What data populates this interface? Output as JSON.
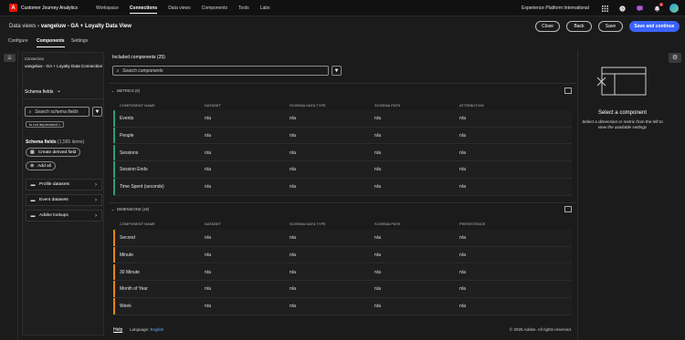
{
  "topbar": {
    "logo": "A",
    "app_title": "Customer Journey Analytics",
    "nav": [
      "Workspace",
      "Connections",
      "Data views",
      "Components",
      "Tools",
      "Labs"
    ],
    "active_nav": "Connections",
    "org_name": "Experience Platform International",
    "notification_count": "1",
    "icons": [
      "apps-grid-icon",
      "help-icon",
      "feedback-icon",
      "bell-icon",
      "avatar"
    ]
  },
  "header": {
    "breadcrumb_root": "Data views",
    "breadcrumb_sep": "›",
    "title": "vangeluw - GA + Loyalty Data View",
    "buttons": {
      "close": "Close",
      "back": "Back",
      "save": "Save",
      "save_continue": "Save and continue"
    }
  },
  "tabs": [
    "Configure",
    "Components",
    "Settings"
  ],
  "active_tab": "Components",
  "left_panel": {
    "connection_label": "Connection",
    "connection_name": "vangeluw - GA + Loyalty Data Connection",
    "schema_select": "Schema fields",
    "search_placeholder": "Search schema fields",
    "filter_tag": "Is not deprecated",
    "schema_fields_label": "Schema fields",
    "schema_fields_count": "(1,565 items)",
    "create_derived": "Create derived field",
    "add_all": "Add all",
    "datasets": [
      "Profile datasets",
      "Event datasets",
      "Adobe lookups"
    ]
  },
  "main": {
    "included_label": "Included components (25)",
    "search_placeholder": "Search components",
    "metrics": {
      "title": "METRICS (6)",
      "columns": [
        "COMPONENT NAME",
        "DATASET",
        "SCHEMA DATA TYPE",
        "SCHEMA PATH",
        "ATTRIBUTION"
      ],
      "rows": [
        [
          "Events",
          "n/a",
          "n/a",
          "n/a",
          "n/a"
        ],
        [
          "People",
          "n/a",
          "n/a",
          "n/a",
          "n/a"
        ],
        [
          "Sessions",
          "n/a",
          "n/a",
          "n/a",
          "n/a"
        ],
        [
          "Session Ends",
          "n/a",
          "n/a",
          "n/a",
          "n/a"
        ],
        [
          "Time Spent (seconds)",
          "n/a",
          "n/a",
          "n/a",
          "n/a"
        ]
      ],
      "accent": "#2d9d78"
    },
    "dimensions": {
      "title": "DIMENSIONS (19)",
      "columns": [
        "COMPONENT NAME",
        "DATASET",
        "SCHEMA DATA TYPE",
        "SCHEMA PATH",
        "PERSISTENCE"
      ],
      "rows": [
        [
          "Second",
          "n/a",
          "n/a",
          "n/a",
          "n/a"
        ],
        [
          "Minute",
          "n/a",
          "n/a",
          "n/a",
          "n/a"
        ],
        [
          "30 Minute",
          "n/a",
          "n/a",
          "n/a",
          "n/a"
        ],
        [
          "Month of Year",
          "n/a",
          "n/a",
          "n/a",
          "n/a"
        ],
        [
          "Week",
          "n/a",
          "n/a",
          "n/a",
          "n/a"
        ]
      ],
      "accent": "#e68619"
    }
  },
  "footer": {
    "help": "Help",
    "language_label": "Language:",
    "language_value": "English",
    "copyright": "© 2025 Adobe. All rights reserved."
  },
  "right_panel": {
    "title": "Select a component",
    "description": "Select a dimension or metric from the left to view the available settings"
  }
}
